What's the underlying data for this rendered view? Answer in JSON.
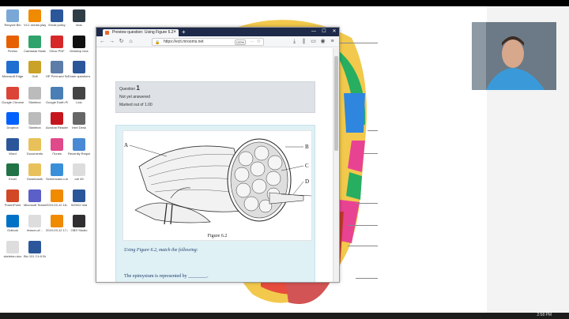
{
  "desktop": {
    "icons": [
      {
        "label": "Recycle Bin",
        "icon": "recycle-bin-icon",
        "color": "#7aa7d6"
      },
      {
        "label": "VLC media player",
        "icon": "vlc-icon",
        "color": "#f08a00"
      },
      {
        "label": "Email policy",
        "icon": "word-doc-icon",
        "color": "#2b579a"
      },
      {
        "label": "bios",
        "icon": "terminal-icon",
        "color": "#2f3e46"
      },
      {
        "label": "Firefox",
        "icon": "firefox-icon",
        "color": "#e66000"
      },
      {
        "label": "Camtasia Studio",
        "icon": "camtasia-icon",
        "color": "#2fa36b"
      },
      {
        "label": "ODoc PDF",
        "icon": "pdf-icon",
        "color": "#d62828"
      },
      {
        "label": "Desktop recs",
        "icon": "folder-black-icon",
        "color": "#111111"
      },
      {
        "label": "Microsoft Edge",
        "icon": "edge-icon",
        "color": "#1f6fd1"
      },
      {
        "label": "Grill",
        "icon": "character-icon",
        "color": "#c9a227"
      },
      {
        "label": "HP Print and Scan Doctor",
        "icon": "printer-icon",
        "color": "#5c7da8"
      },
      {
        "label": "Exam questions",
        "icon": "word-doc-icon",
        "color": "#2b579a"
      },
      {
        "label": "Google Chrome",
        "icon": "chrome-icon",
        "color": "#db4437"
      },
      {
        "label": "Skeleton",
        "icon": "skeleton-icon",
        "color": "#bbbbbb"
      },
      {
        "label": "Google Earth Pro",
        "icon": "earth-icon",
        "color": "#4a7fb5"
      },
      {
        "label": "Lido",
        "icon": "phone-icon",
        "color": "#444444"
      },
      {
        "label": "Dropbox",
        "icon": "dropbox-icon",
        "color": "#0061fe"
      },
      {
        "label": "Skeleton",
        "icon": "skeleton-icon",
        "color": "#bbbbbb"
      },
      {
        "label": "Acrobat Reader DC",
        "icon": "acrobat-icon",
        "color": "#c4161c"
      },
      {
        "label": "Intel Desk",
        "icon": "app-icon",
        "color": "#666666"
      },
      {
        "label": "Word",
        "icon": "word-icon",
        "color": "#2b579a"
      },
      {
        "label": "Documents",
        "icon": "folder-icon",
        "color": "#e8c15a"
      },
      {
        "label": "iTunes",
        "icon": "itunes-icon",
        "color": "#e04a8b"
      },
      {
        "label": "Recently Requests",
        "icon": "globe-icon",
        "color": "#4a8ad4"
      },
      {
        "label": "Excel",
        "icon": "excel-icon",
        "color": "#217346"
      },
      {
        "label": "Downloads",
        "icon": "folder-icon",
        "color": "#e8c15a"
      },
      {
        "label": "Screencast-o-matic",
        "icon": "screencast-icon",
        "color": "#3a8fd9"
      },
      {
        "label": "cdr 49",
        "icon": "file-icon",
        "color": "#dddddd"
      },
      {
        "label": "PowerPoint",
        "icon": "powerpoint-icon",
        "color": "#d24726"
      },
      {
        "label": "Microsoft Teams",
        "icon": "teams-icon",
        "color": "#5b5fc7"
      },
      {
        "label": "2019-03-12 18-10-00",
        "icon": "vlc-icon",
        "color": "#f08a00"
      },
      {
        "label": "W2002 mla",
        "icon": "word-doc-icon",
        "color": "#2b579a"
      },
      {
        "label": "Outlook",
        "icon": "outlook-icon",
        "color": "#0072c6"
      },
      {
        "label": "lesson-of...",
        "icon": "file-icon",
        "color": "#dddddd"
      },
      {
        "label": "2019-03-12 17-22-00",
        "icon": "vlc-icon",
        "color": "#f08a00"
      },
      {
        "label": "OBS Studio",
        "icon": "obs-icon",
        "color": "#302e31"
      },
      {
        "label": "skeleton-doc",
        "icon": "file-icon",
        "color": "#dddddd"
      },
      {
        "label": "Bio 101 Ch 6 Bone",
        "icon": "word-doc-icon",
        "color": "#2b579a"
      }
    ]
  },
  "browser": {
    "tab_title": "Preview question: Using Figure 6.2",
    "url": "https://ecit.mrooms.net",
    "zoom": "120%",
    "win_min": "—",
    "win_max": "☐",
    "win_close": "✕",
    "new_tab": "+"
  },
  "question": {
    "label": "Question",
    "number": "1",
    "status": "Not yet answered",
    "marks": "Marked out of 1.00",
    "figure_caption": "Figure 6.2",
    "figure_labels": [
      "A",
      "B",
      "C",
      "D"
    ],
    "prompt": "Using Figure 6.2, match the following:",
    "stem": "The epimysium is represented by ________."
  },
  "taskbar": {
    "clock": "2:58 PM"
  },
  "colors": {
    "accent_tab": "#1e2a4a",
    "question_bg": "#dff1f5",
    "info_bg": "#dee2e6"
  }
}
